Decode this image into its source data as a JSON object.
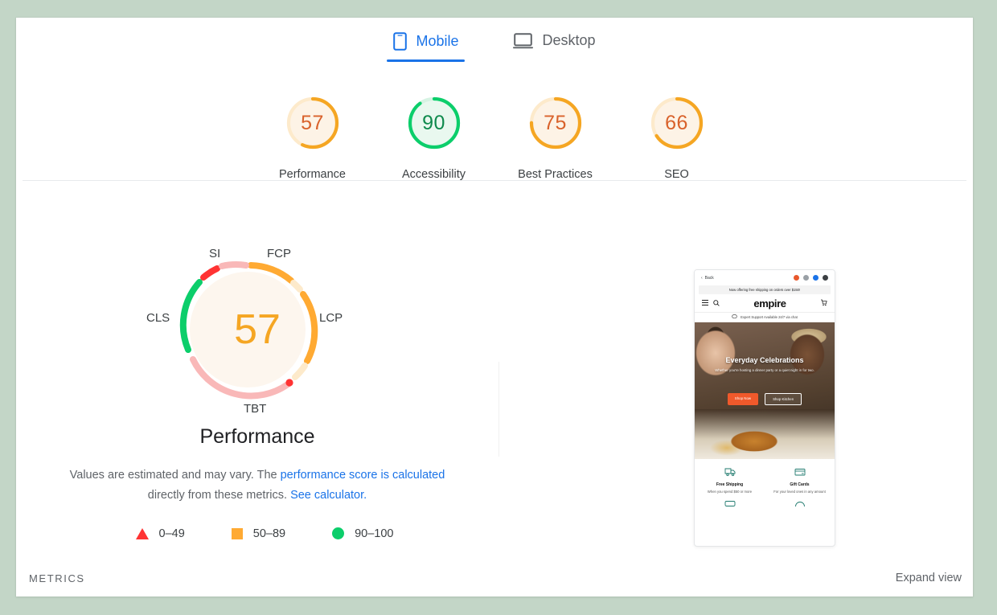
{
  "tabs": [
    {
      "label": "Mobile",
      "icon": "mobile-phone-icon",
      "active": true
    },
    {
      "label": "Desktop",
      "icon": "desktop-monitor-icon",
      "active": false
    }
  ],
  "scores": [
    {
      "label": "Performance",
      "value": "57",
      "color": "#f5a623",
      "fill": "#fdf3e6",
      "dash": 57
    },
    {
      "label": "Accessibility",
      "value": "90",
      "color": "#0cce6b",
      "fill": "#e9f8ef",
      "dash": 90
    },
    {
      "label": "Best Practices",
      "value": "75",
      "color": "#f5a623",
      "fill": "#fdf3e6",
      "dash": 75
    },
    {
      "label": "SEO",
      "value": "66",
      "color": "#f5a623",
      "fill": "#fdf3e6",
      "dash": 66
    }
  ],
  "performance": {
    "score": "57",
    "title": "Performance",
    "score_color": "#f5a623",
    "center_fill": "#fdf6ee",
    "metrics": [
      {
        "key": "FCP",
        "label": "FCP",
        "color": "#fa3",
        "track": "#fdeacb"
      },
      {
        "key": "LCP",
        "label": "LCP",
        "color": "#fa3",
        "track": "#fdeacb"
      },
      {
        "key": "TBT",
        "label": "TBT",
        "color": "#f9b8b8",
        "marker": "#f33"
      },
      {
        "key": "CLS",
        "label": "CLS",
        "color": "#0cce6b",
        "track": "#0cce6b"
      },
      {
        "key": "SI",
        "label": "SI",
        "color": "#f33",
        "track": "#f9b8b8"
      }
    ],
    "description_pre": "Values are estimated and may vary. The ",
    "description_link1": "performance score is calculated",
    "description_mid": " directly from these metrics. ",
    "description_link2": "See calculator.",
    "legend": [
      {
        "shape": "triangle",
        "label": "0–49",
        "color": "#f33"
      },
      {
        "shape": "square",
        "label": "50–89",
        "color": "#fa3"
      },
      {
        "shape": "circle",
        "label": "90–100",
        "color": "#0cce6b"
      }
    ]
  },
  "preview": {
    "back_label": "Back",
    "dots": [
      "#e8582c",
      "#9aa0a6",
      "#1a73e8",
      "#3c4043"
    ],
    "promo": "Now offering free shipping on orders over $150!",
    "brand": "empire",
    "support": "Expert Support  Available 24/7 via chat",
    "hero_heading": "Everyday Celebrations",
    "hero_sub": "Whether you're hosting a dinner party or a quiet night in for two.",
    "hero_btn_primary": "Shop Now",
    "hero_btn_secondary": "Shop Kitchen",
    "features": [
      {
        "icon": "shipping-truck-icon",
        "title": "Free Shipping",
        "desc": "When you spend $50 or more"
      },
      {
        "icon": "gift-card-icon",
        "title": "Gift Cards",
        "desc": "For your loved ones in any amount"
      }
    ]
  },
  "footer": {
    "section_label": "METRICS",
    "expand_label": "Expand view"
  }
}
